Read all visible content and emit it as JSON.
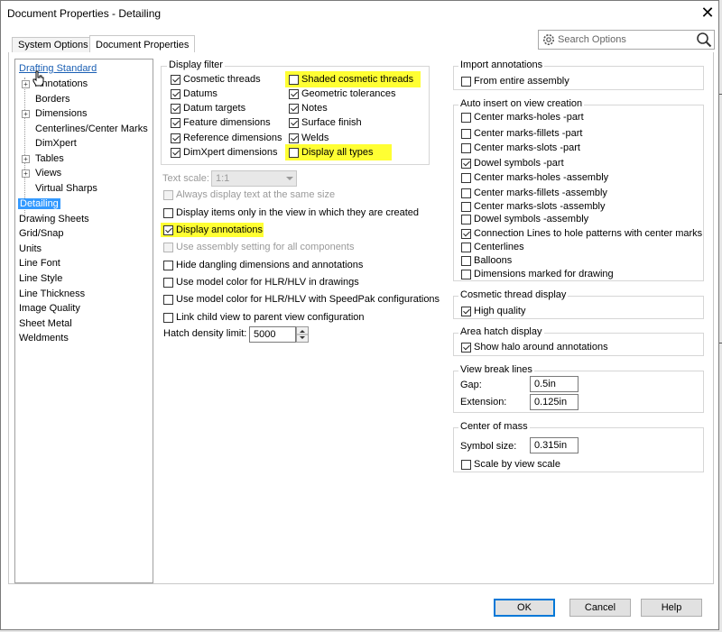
{
  "window": {
    "title": "Document Properties - Detailing",
    "close_glyph": "✕"
  },
  "tabs": [
    {
      "label": "System Options",
      "active": false
    },
    {
      "label": "Document Properties",
      "active": true
    }
  ],
  "search": {
    "placeholder": "Search Options"
  },
  "tree": {
    "items": [
      {
        "label": "Drafting Standard",
        "kind": "link"
      },
      {
        "label": "Annotations",
        "expand": "+"
      },
      {
        "label": "Borders"
      },
      {
        "label": "Dimensions",
        "expand": "+"
      },
      {
        "label": "Centerlines/Center Marks"
      },
      {
        "label": "DimXpert"
      },
      {
        "label": "Tables",
        "expand": "+"
      },
      {
        "label": "Views",
        "expand": "+"
      },
      {
        "label": "Virtual Sharps"
      },
      {
        "label": "Detailing",
        "selected": true
      },
      {
        "label": "Drawing Sheets"
      },
      {
        "label": "Grid/Snap"
      },
      {
        "label": "Units"
      },
      {
        "label": "Line Font"
      },
      {
        "label": "Line Style"
      },
      {
        "label": "Line Thickness"
      },
      {
        "label": "Image Quality"
      },
      {
        "label": "Sheet Metal"
      },
      {
        "label": "Weldments"
      }
    ]
  },
  "display_filter": {
    "title": "Display filter",
    "left": [
      {
        "label": "Cosmetic threads",
        "checked": true
      },
      {
        "label": "Datums",
        "checked": true
      },
      {
        "label": "Datum targets",
        "checked": true
      },
      {
        "label": "Feature dimensions",
        "checked": true
      },
      {
        "label": "Reference dimensions",
        "checked": true
      },
      {
        "label": "DimXpert dimensions",
        "checked": true
      }
    ],
    "right": [
      {
        "label": "Shaded cosmetic threads",
        "checked": false,
        "highlight": true
      },
      {
        "label": "Geometric tolerances",
        "checked": true
      },
      {
        "label": "Notes",
        "checked": true
      },
      {
        "label": "Surface finish",
        "checked": true
      },
      {
        "label": "Welds",
        "checked": true
      },
      {
        "label": "Display all types",
        "checked": false,
        "highlight": true
      }
    ]
  },
  "text_scale": {
    "label": "Text scale:",
    "value": "1:1"
  },
  "options": [
    {
      "label": "Always display text at the same size",
      "checked": false,
      "disabled": true
    },
    {
      "label": "Display items only in the view in which they are created",
      "checked": false
    },
    {
      "label": "Display annotations",
      "checked": true,
      "highlight": true
    },
    {
      "label": "Use assembly setting for all components",
      "checked": false,
      "disabled": true
    },
    {
      "label": "Hide dangling dimensions and annotations",
      "checked": false
    },
    {
      "label": "Use model color for HLR/HLV in drawings",
      "checked": false
    },
    {
      "label": "Use model color for HLR/HLV with SpeedPak configurations",
      "checked": false
    },
    {
      "label": "Link child view to parent view configuration",
      "checked": false
    }
  ],
  "hatch_density": {
    "label": "Hatch density limit:",
    "value": "5000"
  },
  "import_annotations": {
    "title": "Import annotations",
    "items": [
      {
        "label": "From entire assembly",
        "checked": false
      }
    ]
  },
  "auto_insert": {
    "title": "Auto insert on view creation",
    "items": [
      {
        "label": "Center marks-holes -part",
        "checked": false
      },
      {
        "label": "Center marks-fillets -part",
        "checked": false
      },
      {
        "label": "Center marks-slots  -part",
        "checked": false
      },
      {
        "label": "Dowel symbols -part",
        "checked": true
      },
      {
        "label": "Center marks-holes -assembly",
        "checked": false
      },
      {
        "label": "Center marks-fillets -assembly",
        "checked": false
      },
      {
        "label": "Center marks-slots  -assembly",
        "checked": false
      },
      {
        "label": "Dowel symbols -assembly",
        "checked": false
      },
      {
        "label": "Connection Lines to hole patterns with center marks",
        "checked": true
      },
      {
        "label": "Centerlines",
        "checked": false
      },
      {
        "label": "Balloons",
        "checked": false
      },
      {
        "label": "Dimensions marked for drawing",
        "checked": false
      }
    ]
  },
  "cosmetic_thread": {
    "title": "Cosmetic thread display",
    "items": [
      {
        "label": "High quality",
        "checked": true
      }
    ]
  },
  "area_hatch": {
    "title": "Area hatch display",
    "items": [
      {
        "label": "Show halo around annotations",
        "checked": true
      }
    ]
  },
  "view_break": {
    "title": "View break lines",
    "gap_label": "Gap:",
    "gap_value": "0.5in",
    "ext_label": "Extension:",
    "ext_value": "0.125in"
  },
  "center_of_mass": {
    "title": "Center of mass",
    "size_label": "Symbol size:",
    "size_value": "0.315in",
    "items": [
      {
        "label": "Scale by view scale",
        "checked": false
      }
    ]
  },
  "buttons": {
    "ok": "OK",
    "cancel": "Cancel",
    "help": "Help"
  },
  "colors": {
    "highlight": "#ffff33",
    "selection": "#3399ff",
    "link": "#1a5fb4",
    "default_button_border": "#0078d7"
  }
}
